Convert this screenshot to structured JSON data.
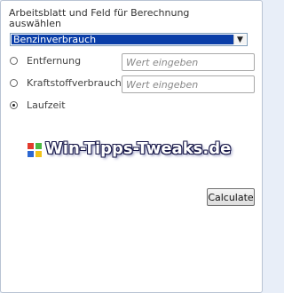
{
  "header": {
    "label": "Arbeitsblatt und Feld für Berechnung auswählen"
  },
  "sheet_select": {
    "selected": "Benzinverbrauch",
    "arrow_icon": "chevron-down-icon"
  },
  "options": [
    {
      "label": "Entfernung",
      "checked": false,
      "input_placeholder": "Wert eingeben",
      "input_value": ""
    },
    {
      "label": "Kraftstoffverbrauch",
      "checked": false,
      "input_placeholder": "Wert eingeben",
      "input_value": ""
    },
    {
      "label": "Laufzeit",
      "checked": true
    }
  ],
  "watermark": {
    "text": "Win-Tipps-Tweaks.de",
    "icon": "windows-logo-icon"
  },
  "actions": {
    "calculate_label": "Calculate"
  }
}
